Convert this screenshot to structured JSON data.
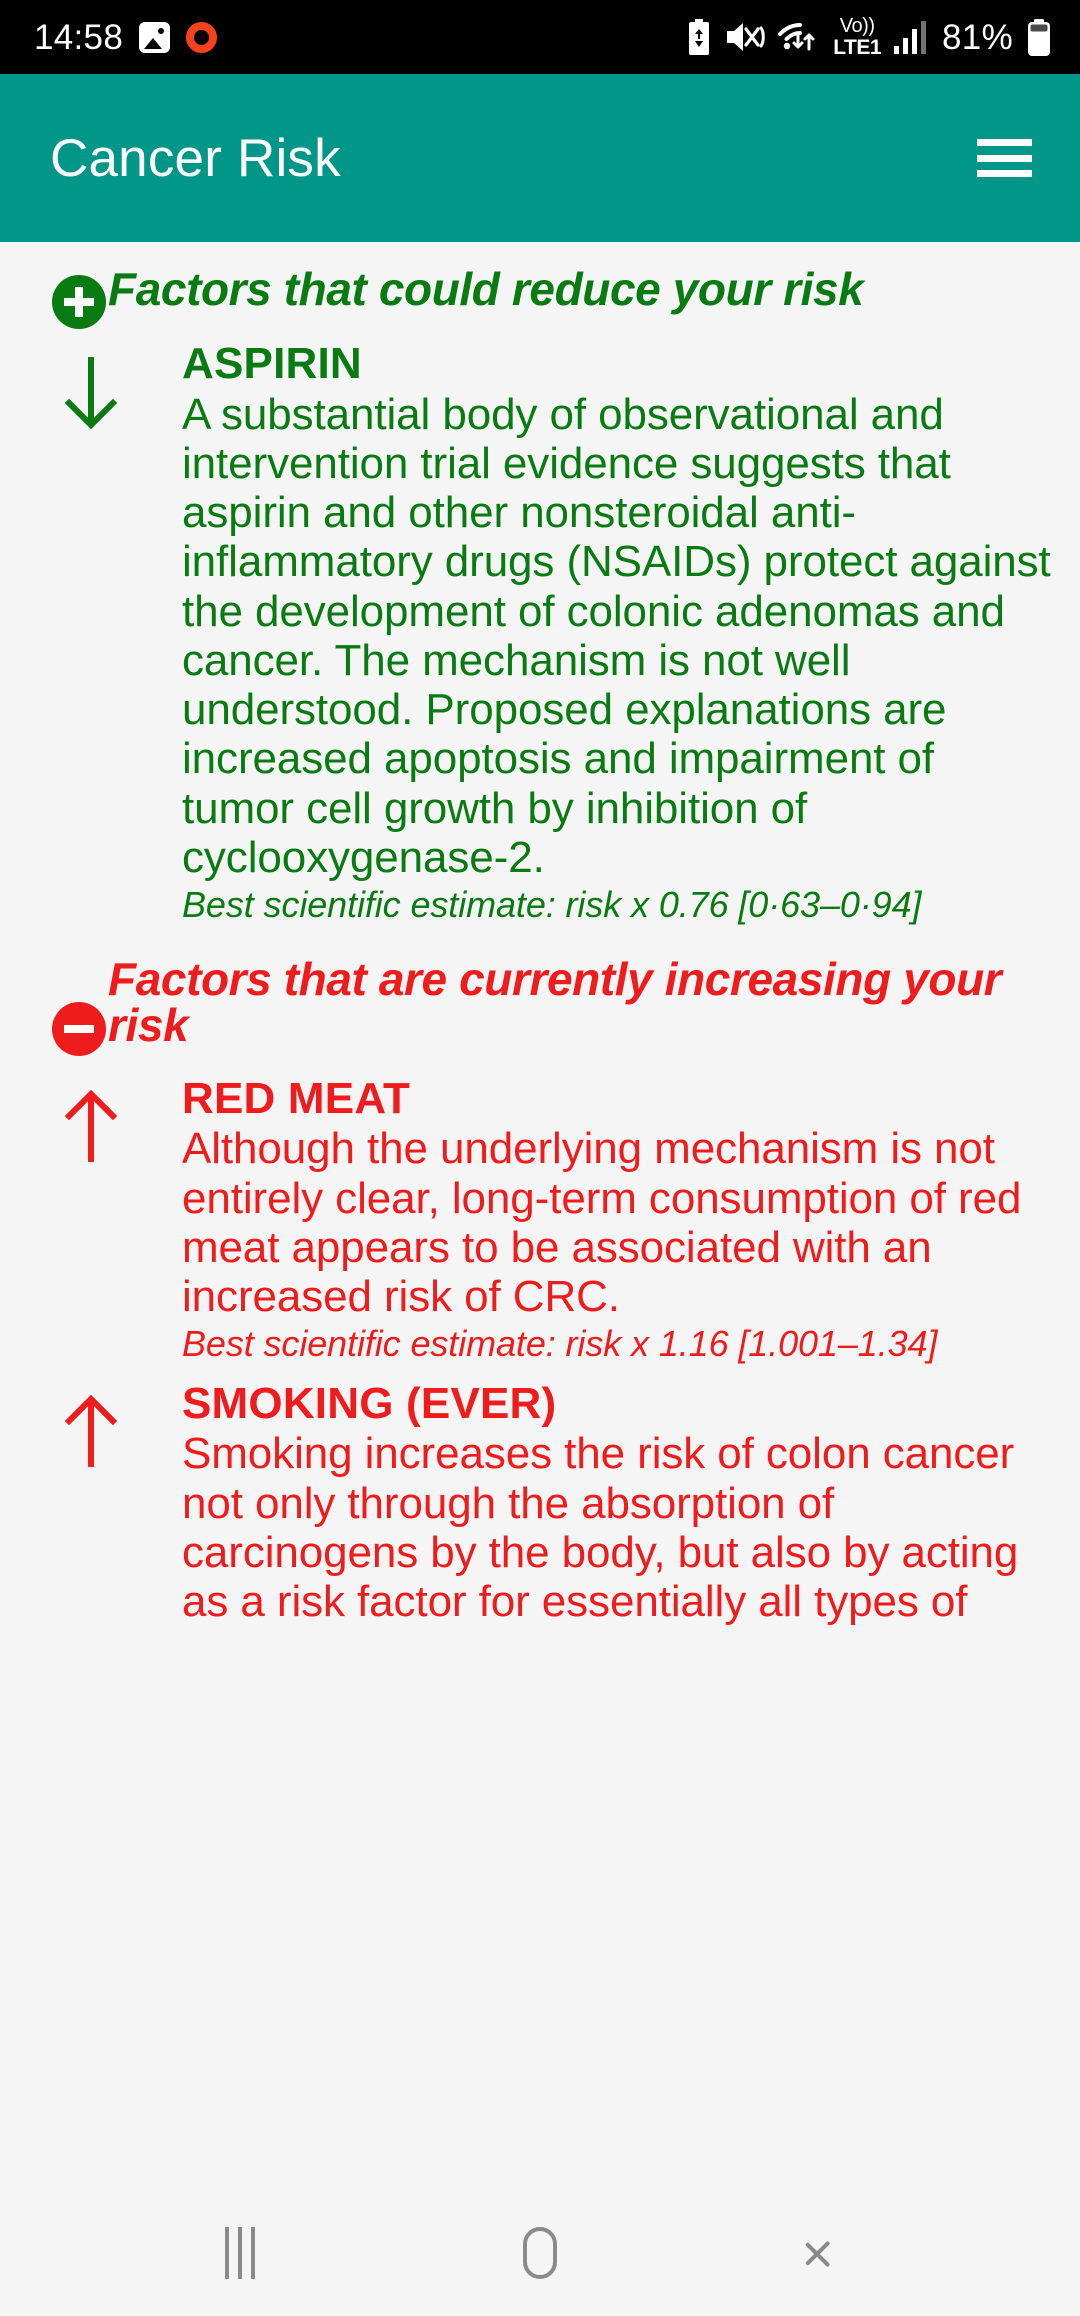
{
  "status_bar": {
    "time": "14:58",
    "battery_percent": "81%",
    "network_label_top": "Vo))",
    "network_label_bottom": "LTE1",
    "icons": [
      "gallery-icon",
      "orange-ring-icon",
      "battery-saver-icon",
      "mute-vibrate-icon",
      "wifi-data-icon",
      "volte-icon",
      "signal-bars-icon",
      "battery-icon"
    ]
  },
  "app_bar": {
    "title": "Cancer Risk",
    "menu_icon": "hamburger-menu-icon"
  },
  "colors": {
    "accent_teal": "#009688",
    "reduce_green": "#0a7a12",
    "increase_red": "#ee1c1c",
    "page_background": "#f5f5f5",
    "status_bar_background": "#000000"
  },
  "sections": [
    {
      "id": "reduce",
      "badge": "plus-circle-icon",
      "title": "Factors that could reduce your risk",
      "color": "#0a7a12",
      "factors": [
        {
          "arrow": "arrow-down-icon",
          "name": "ASPIRIN",
          "description": "A substantial body of observational and intervention trial evidence suggests that aspirin and other nonsteroidal anti-inflammatory drugs (NSAIDs) protect against the development of colonic adenomas and cancer. The mechanism is not well understood. Proposed explanations are increased apoptosis and impairment of tumor cell growth by inhibition of cyclooxygenase-2.",
          "estimate": "Best scientific estimate: risk x 0.76 [0·63–0·94]"
        }
      ]
    },
    {
      "id": "increase",
      "badge": "minus-circle-icon",
      "title": "Factors that are currently increasing your risk",
      "color": "#ee1c1c",
      "factors": [
        {
          "arrow": "arrow-up-icon",
          "name": "RED MEAT",
          "description": "Although the underlying mechanism is not entirely clear, long-term consumption of red meat appears to be associated with an increased risk of CRC.",
          "estimate": "Best scientific estimate: risk x 1.16 [1.001–1.34]"
        },
        {
          "arrow": "arrow-up-icon",
          "name": "SMOKING (EVER)",
          "description": "Smoking increases the risk of colon cancer not only through the absorption of carcinogens by the body, but also by acting as a risk factor for essentially all types of",
          "estimate": ""
        }
      ]
    }
  ],
  "nav_bar": {
    "recents_label": "recents-button",
    "home_label": "home-button",
    "back_label": "back-button"
  }
}
